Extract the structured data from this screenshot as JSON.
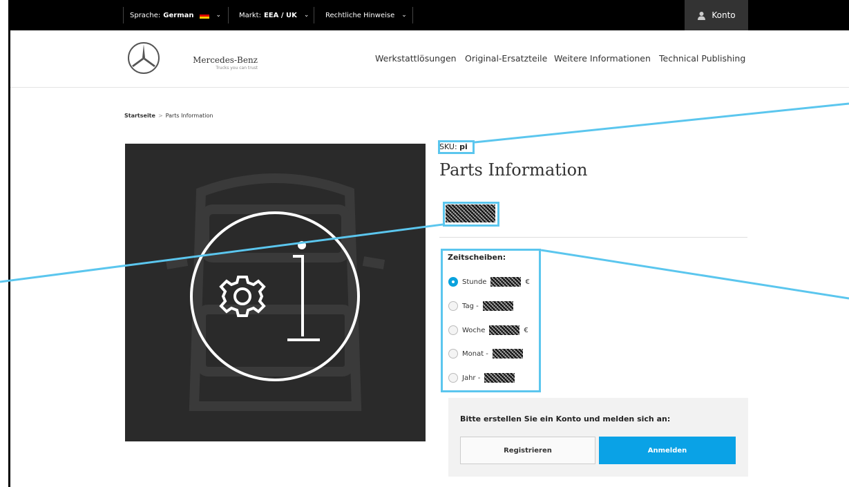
{
  "topbar": {
    "language_label": "Sprache:",
    "language_value": "German",
    "market_label": "Markt:",
    "market_value": "EEA / UK",
    "legal_label": "Rechtliche Hinweise",
    "account_label": "Konto"
  },
  "brand": {
    "name": "Mercedes-Benz",
    "tagline": "Trucks you can trust"
  },
  "nav": [
    {
      "label": "Werkstattlösungen"
    },
    {
      "label": "Original-Ersatzteile"
    },
    {
      "label": "Weitere Informationen"
    },
    {
      "label": "Technical Publishing"
    }
  ],
  "breadcrumb": {
    "home": "Startseite",
    "separator": ">",
    "current": "Parts Information"
  },
  "product": {
    "sku_label": "SKU:",
    "sku_value": "pi",
    "title": "Parts Information",
    "price": "[redacted]"
  },
  "timeslices": {
    "label": "Zeitscheiben:",
    "options": [
      {
        "prefix": "Stunde",
        "suffix": "€",
        "selected": true
      },
      {
        "prefix": "Tag -",
        "suffix": "",
        "selected": false
      },
      {
        "prefix": "Woche",
        "suffix": "€",
        "selected": false
      },
      {
        "prefix": "Monat -",
        "suffix": "",
        "selected": false
      },
      {
        "prefix": "Jahr -",
        "suffix": "",
        "selected": false
      }
    ]
  },
  "login": {
    "prompt": "Bitte erstellen Sie ein Konto und melden sich an:",
    "register_label": "Registrieren",
    "login_label": "Anmelden"
  },
  "colors": {
    "highlight": "#5bc6ee",
    "accent_blue": "#0aa2e6",
    "topbar_bg": "#000000",
    "image_bg": "#2a2a2a"
  },
  "icons": [
    "user-icon",
    "mercedes-star-icon",
    "gear-info-icon",
    "truck-silhouette-icon",
    "chevron-down-icon"
  ]
}
